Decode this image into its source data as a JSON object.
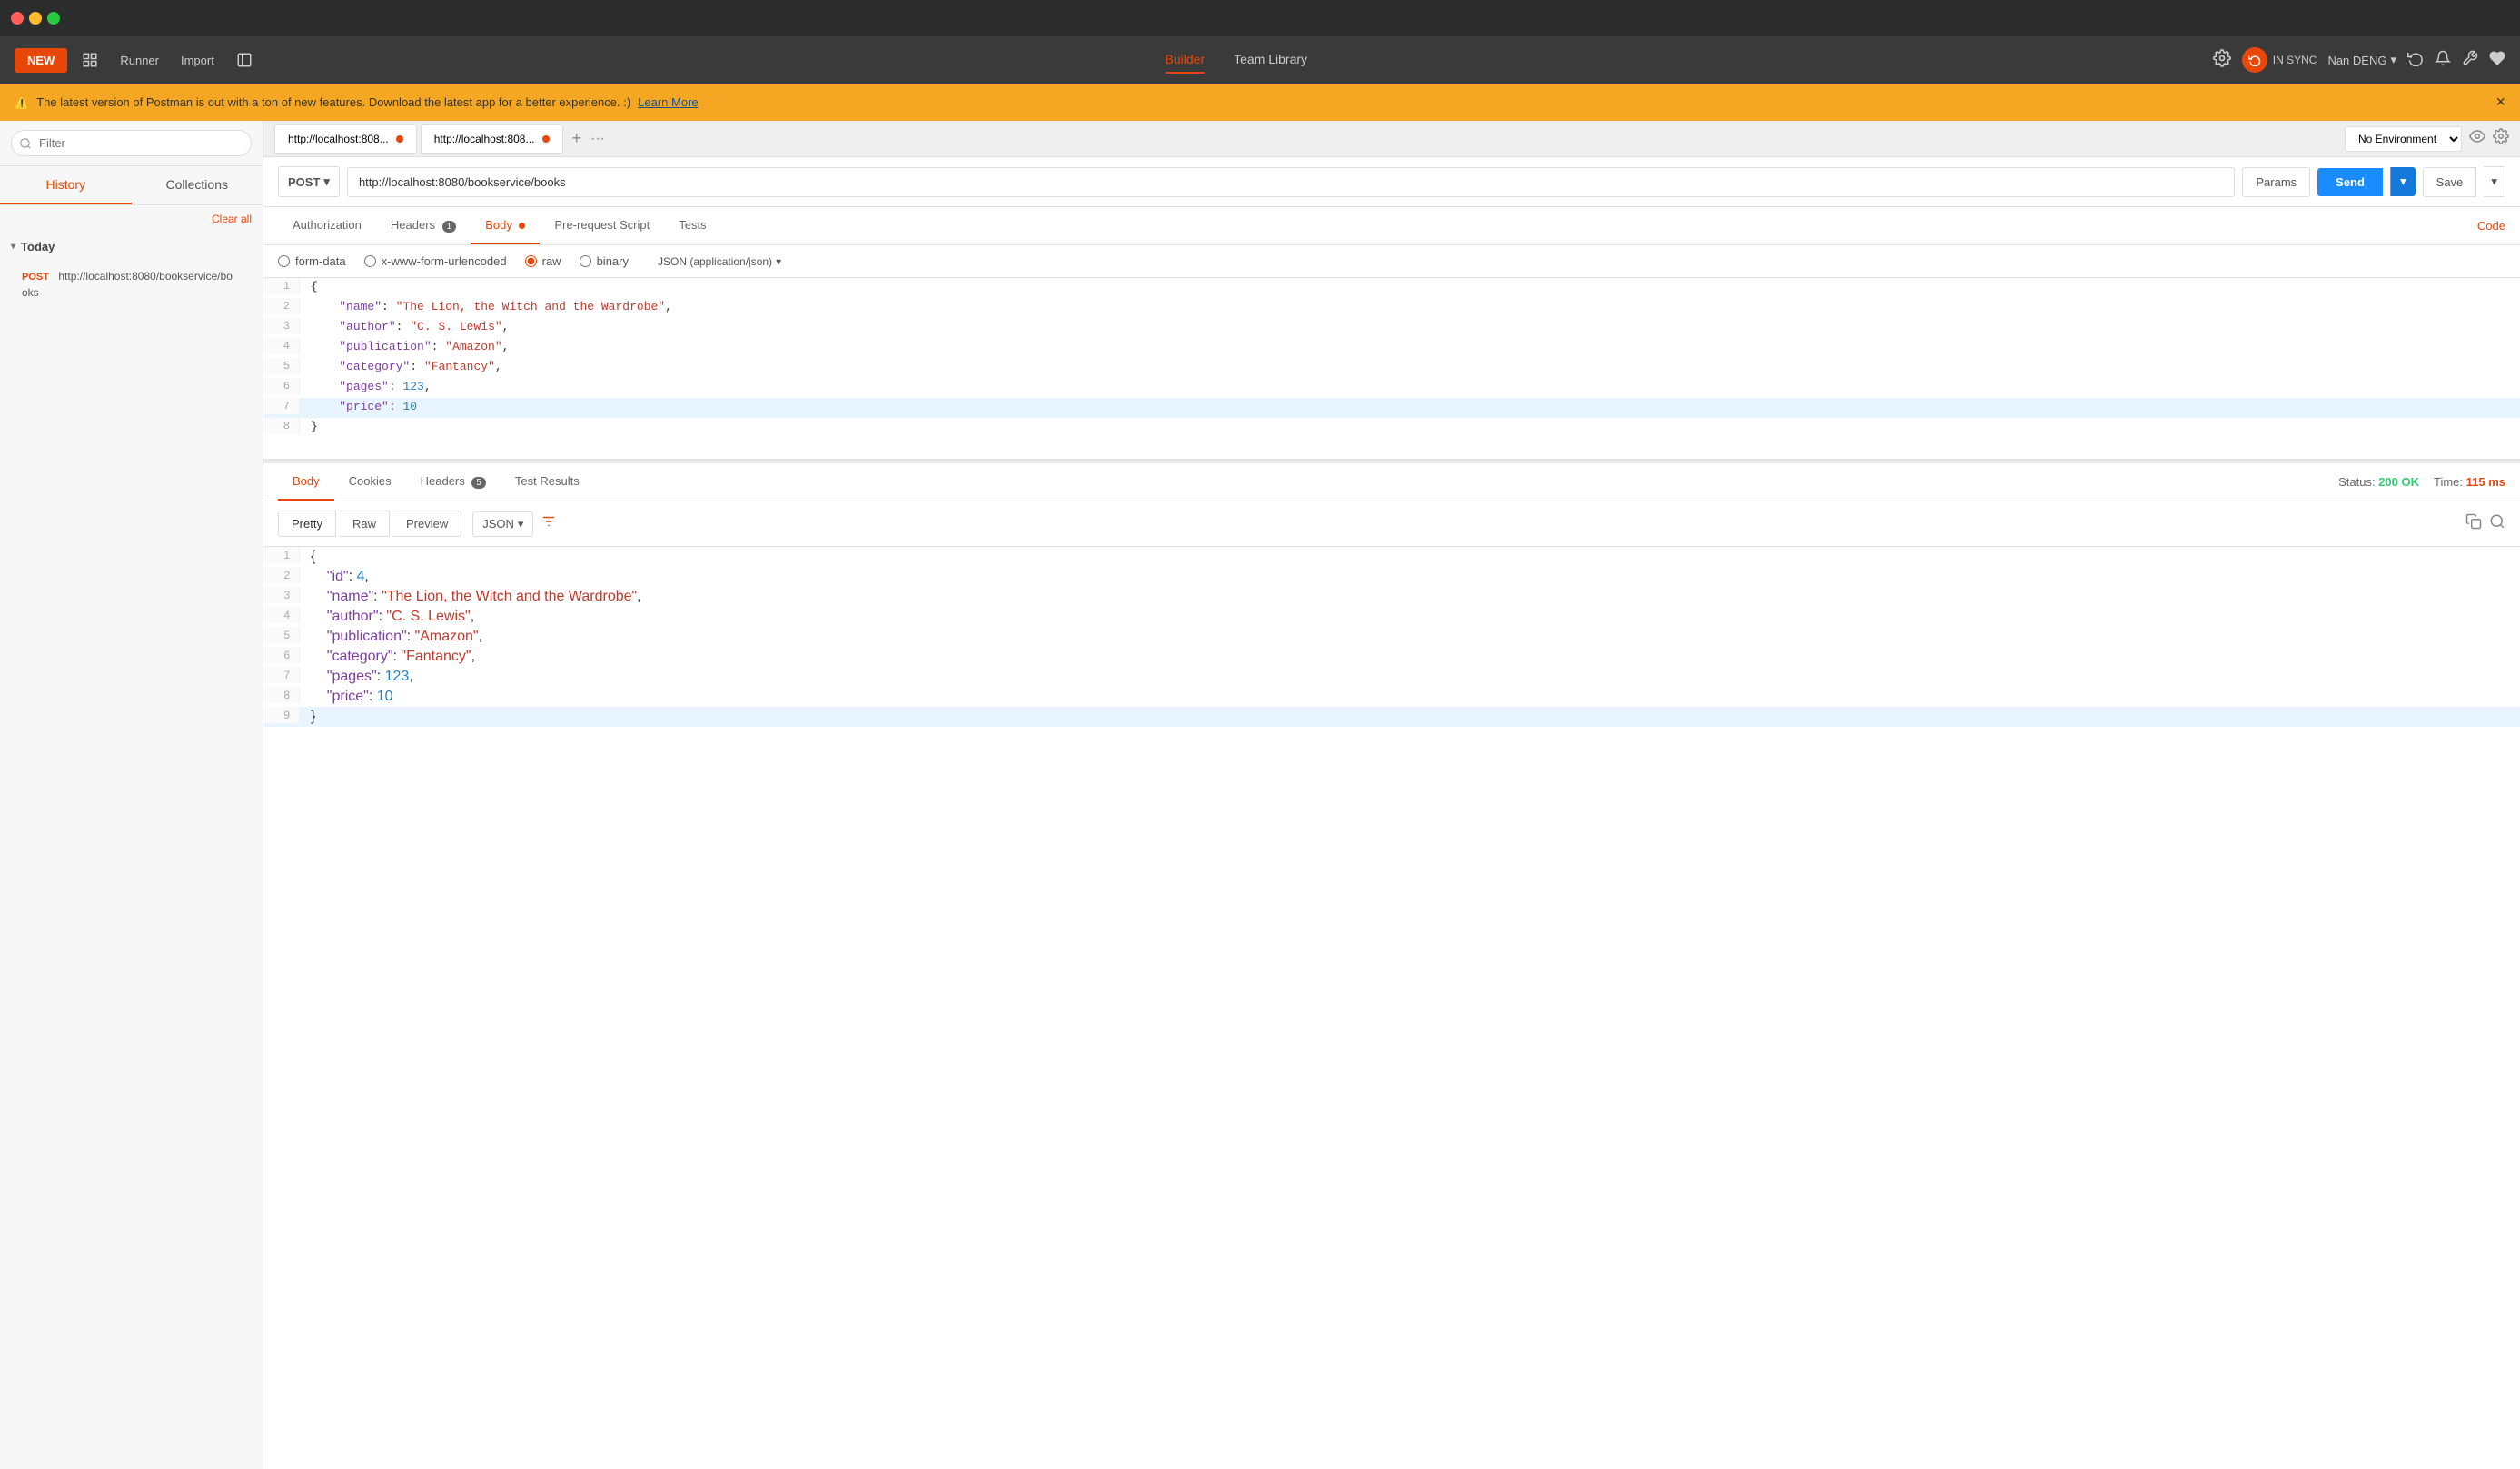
{
  "titlebar": {
    "traffic_lights": [
      "red",
      "yellow",
      "green"
    ]
  },
  "toolbar": {
    "new_label": "NEW",
    "runner_label": "Runner",
    "import_label": "Import",
    "builder_label": "Builder",
    "team_library_label": "Team Library",
    "sync_label": "IN SYNC",
    "user_label": "Nan DENG",
    "settings_icon": "⚙",
    "bell_icon": "🔔",
    "wrench_icon": "🔧",
    "heart_icon": "♥"
  },
  "banner": {
    "message": "The latest version of Postman is out with a ton of new features. Download the latest app for a better experience. :)",
    "learn_more": "Learn More"
  },
  "sidebar": {
    "filter_placeholder": "Filter",
    "history_label": "History",
    "collections_label": "Collections",
    "clear_all_label": "Clear all",
    "today_label": "Today",
    "history_item": {
      "method": "POST",
      "url": "http://localhost:8080/bookservice/books"
    }
  },
  "env": {
    "label": "No Environment",
    "options": [
      "No Environment"
    ]
  },
  "tabs": [
    {
      "label": "http://localhost:808...",
      "has_dot": true
    },
    {
      "label": "http://localhost:808...",
      "has_dot": true
    }
  ],
  "request": {
    "method": "POST",
    "url": "http://localhost:8080/bookservice/books",
    "tabs": [
      {
        "label": "Authorization",
        "active": false
      },
      {
        "label": "Headers",
        "badge": "1",
        "active": false
      },
      {
        "label": "Body",
        "active": true,
        "has_dot": true
      },
      {
        "label": "Pre-request Script",
        "active": false
      },
      {
        "label": "Tests",
        "active": false
      }
    ],
    "body_options": [
      {
        "label": "form-data",
        "value": "form-data"
      },
      {
        "label": "x-www-form-urlencoded",
        "value": "urlencoded"
      },
      {
        "label": "raw",
        "value": "raw",
        "selected": true
      },
      {
        "label": "binary",
        "value": "binary"
      }
    ],
    "json_type": "JSON (application/json)",
    "code_lines": [
      {
        "num": 1,
        "content": "{",
        "parts": []
      },
      {
        "num": 2,
        "content": "    \"name\": \"The Lion, the Witch and the Wardrobe\",",
        "key": "name",
        "val": "The Lion, the Witch and the Wardrobe"
      },
      {
        "num": 3,
        "content": "    \"author\": \"C. S. Lewis\",",
        "key": "author",
        "val": "C. S. Lewis"
      },
      {
        "num": 4,
        "content": "    \"publication\": \"Amazon\",",
        "key": "publication",
        "val": "Amazon"
      },
      {
        "num": 5,
        "content": "    \"category\": \"Fantancy\",",
        "key": "category",
        "val": "Fantancy"
      },
      {
        "num": 6,
        "content": "    \"pages\": 123,",
        "key": "pages",
        "val": 123
      },
      {
        "num": 7,
        "content": "    \"price\": 10",
        "key": "price",
        "val": 10,
        "selected": true
      },
      {
        "num": 8,
        "content": "}",
        "parts": []
      }
    ]
  },
  "response": {
    "tabs": [
      {
        "label": "Body",
        "active": true
      },
      {
        "label": "Cookies",
        "active": false
      },
      {
        "label": "Headers",
        "badge": "5",
        "active": false
      },
      {
        "label": "Test Results",
        "active": false
      }
    ],
    "status_label": "Status:",
    "status_value": "200 OK",
    "time_label": "Time:",
    "time_value": "115 ms",
    "view_tabs": [
      {
        "label": "Pretty",
        "active": true
      },
      {
        "label": "Raw",
        "active": false
      },
      {
        "label": "Preview",
        "active": false
      }
    ],
    "format": "JSON",
    "code_lines": [
      {
        "num": 1,
        "content": "{"
      },
      {
        "num": 2,
        "content": "    \"id\": 4,"
      },
      {
        "num": 3,
        "content": "    \"name\": \"The Lion, the Witch and the Wardrobe\","
      },
      {
        "num": 4,
        "content": "    \"author\": \"C. S. Lewis\","
      },
      {
        "num": 5,
        "content": "    \"publication\": \"Amazon\","
      },
      {
        "num": 6,
        "content": "    \"category\": \"Fantancy\","
      },
      {
        "num": 7,
        "content": "    \"pages\": 123,"
      },
      {
        "num": 8,
        "content": "    \"price\": 10"
      },
      {
        "num": 9,
        "content": "}"
      }
    ]
  },
  "labels": {
    "params": "Params",
    "send": "Send",
    "save": "Save",
    "code": "Code"
  }
}
